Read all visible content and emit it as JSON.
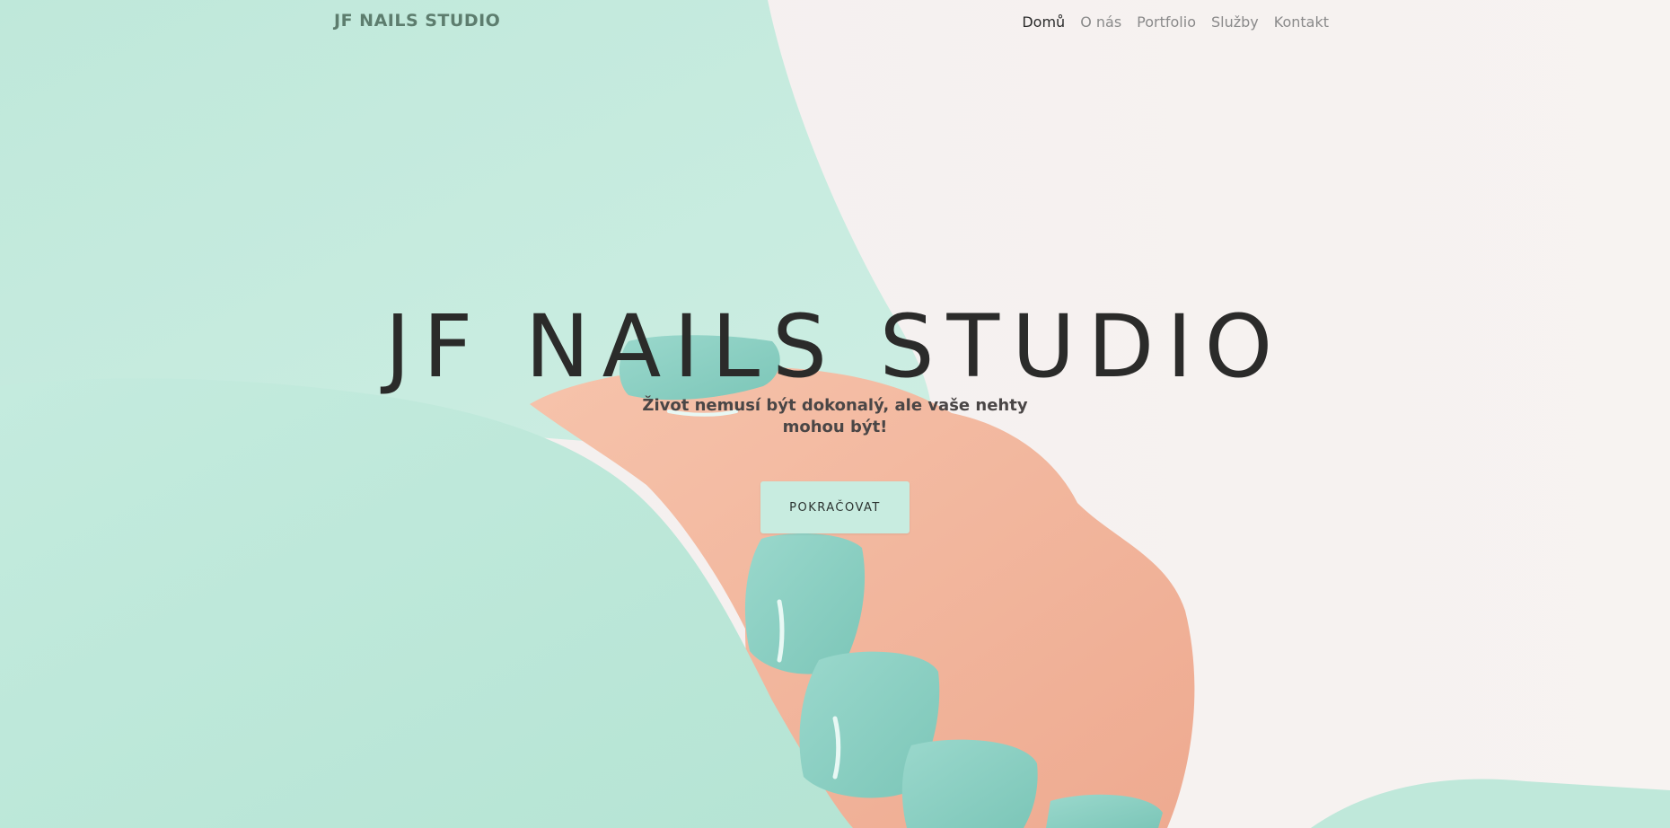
{
  "navbar": {
    "brand": "JF NAILS STUDIO",
    "links": [
      {
        "label": "Domů",
        "active": true
      },
      {
        "label": "O nás",
        "active": false
      },
      {
        "label": "Portfolio",
        "active": false
      },
      {
        "label": "Služby",
        "active": false
      },
      {
        "label": "Kontakt",
        "active": false
      }
    ]
  },
  "hero": {
    "title": "JF NAILS STUDIO",
    "subtitle": "Život nemusí být dokonalý, ale vaše nehty mohou být!",
    "button_label": "POKRAČOVAT"
  },
  "colors": {
    "mint": "#c8ece0",
    "nail": "#8fd1c6",
    "skin": "#f2b9a0",
    "background": "#f4f1f1",
    "brand_text": "#5d7d6e"
  }
}
